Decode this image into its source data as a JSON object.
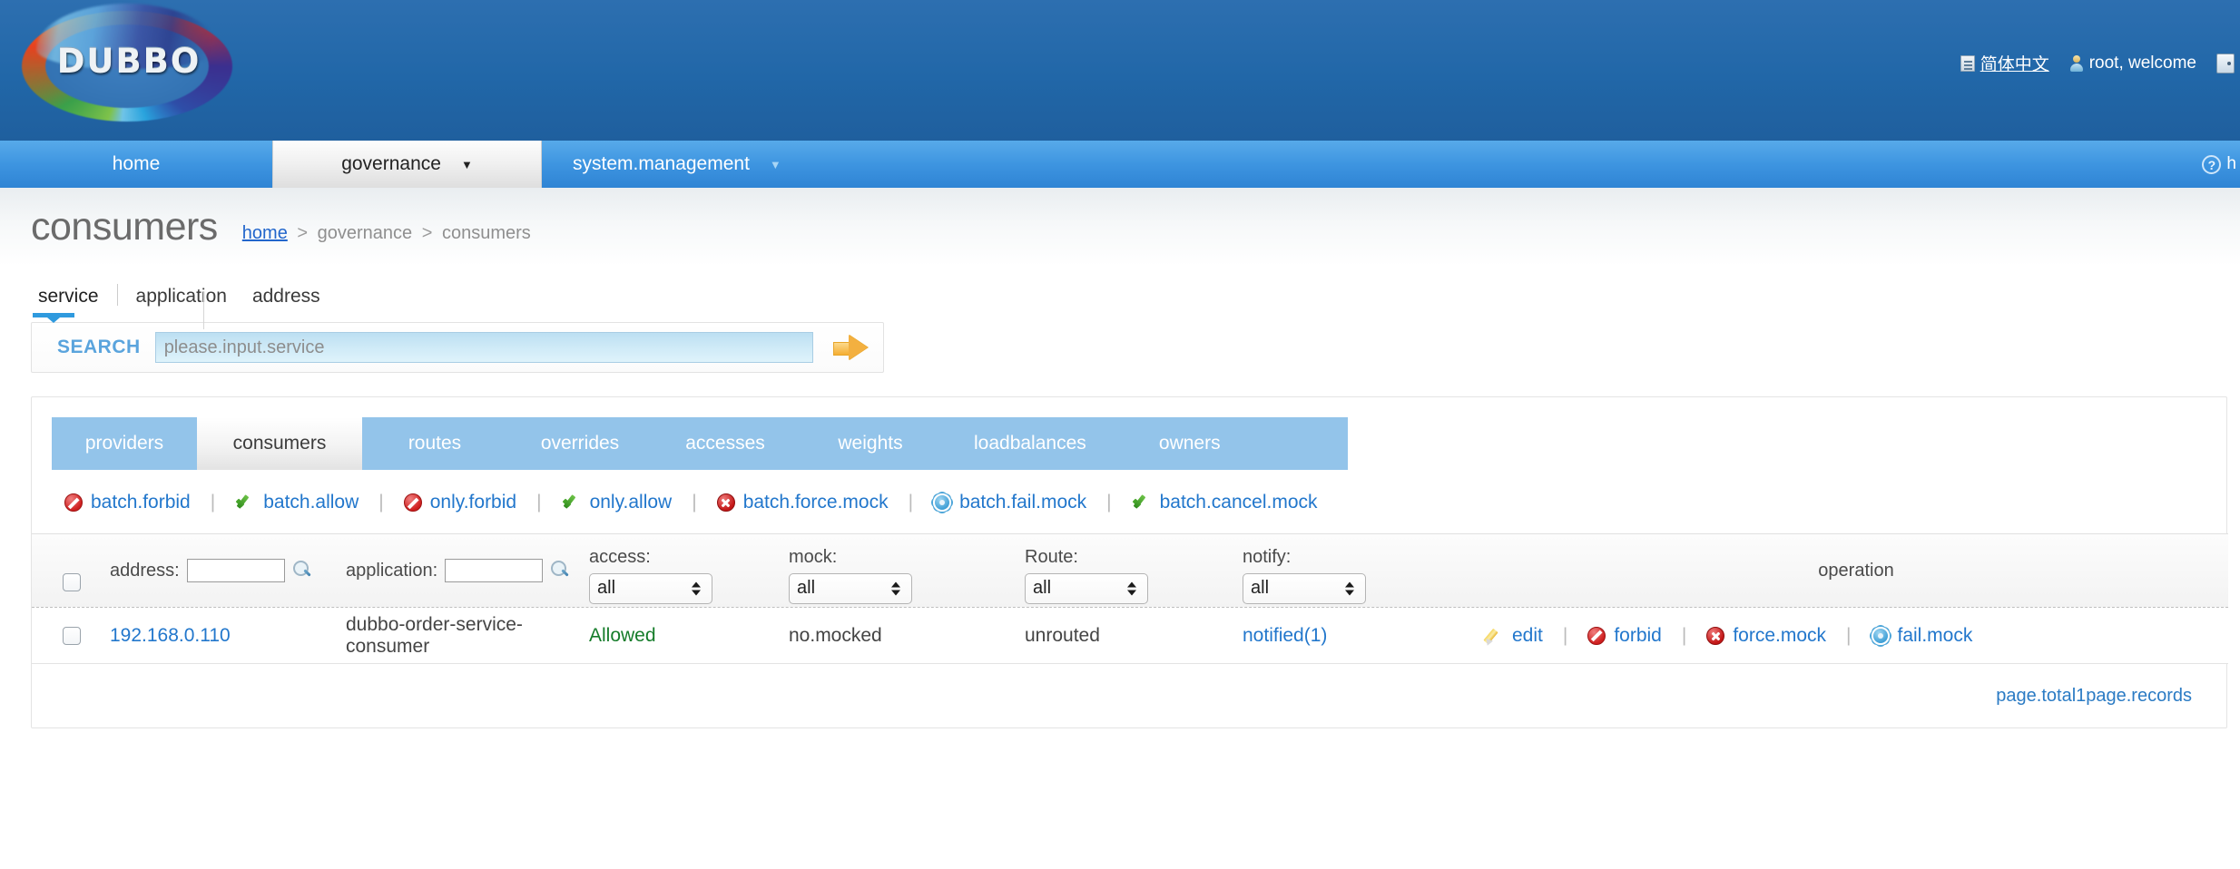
{
  "header": {
    "logo_text": "DUBBO",
    "language_link": "简体中文",
    "language_icon": "document-icon",
    "user_greeting": "root, welcome",
    "user_icon": "user-icon",
    "logout_icon": "door-exit-icon"
  },
  "nav": {
    "items": [
      {
        "label": "home",
        "active": false,
        "caret": false
      },
      {
        "label": "governance",
        "active": true,
        "caret": true
      },
      {
        "label": "system.management",
        "active": false,
        "caret": true
      }
    ],
    "help_icon": "question-circle-icon",
    "help_label": "h"
  },
  "page": {
    "title": "consumers",
    "breadcrumb": {
      "home": "home",
      "sep1": ">",
      "governance": "governance",
      "sep2": ">",
      "current": "consumers"
    }
  },
  "subtabs": {
    "items": [
      {
        "label": "service",
        "selected": true
      },
      {
        "label": "application",
        "selected": false
      },
      {
        "label": "address",
        "selected": false
      }
    ]
  },
  "search": {
    "label": "SEARCH",
    "placeholder": "please.input.service",
    "value": "",
    "submit_icon": "arrow-right-icon"
  },
  "tabs": {
    "items": [
      {
        "label": "providers",
        "active": false
      },
      {
        "label": "consumers",
        "active": true
      },
      {
        "label": "routes",
        "active": false
      },
      {
        "label": "overrides",
        "active": false
      },
      {
        "label": "accesses",
        "active": false
      },
      {
        "label": "weights",
        "active": false
      },
      {
        "label": "loadbalances",
        "active": false
      },
      {
        "label": "owners",
        "active": false
      }
    ]
  },
  "batch_actions": [
    {
      "label": "batch.forbid",
      "icon": "forbid-icon"
    },
    {
      "label": "batch.allow",
      "icon": "check-icon"
    },
    {
      "label": "only.forbid",
      "icon": "forbid-icon"
    },
    {
      "label": "only.allow",
      "icon": "check-icon"
    },
    {
      "label": "batch.force.mock",
      "icon": "error-circle-icon"
    },
    {
      "label": "batch.fail.mock",
      "icon": "gear-icon"
    },
    {
      "label": "batch.cancel.mock",
      "icon": "check-icon"
    }
  ],
  "separator": "|",
  "filters": {
    "address_label": "address:",
    "address_value": "",
    "address_search_icon": "magnifier-icon",
    "application_label": "application:",
    "application_value": "",
    "application_search_icon": "magnifier-icon",
    "access_label": "access:",
    "access_value": "all",
    "mock_label": "mock:",
    "mock_value": "all",
    "route_label": "Route:",
    "route_value": "all",
    "notify_label": "notify:",
    "notify_value": "all",
    "operation_label": "operation"
  },
  "rows": [
    {
      "address": "192.168.0.110",
      "application": "dubbo-order-service-consumer",
      "access": "Allowed",
      "mock": "no.mocked",
      "route": "unrouted",
      "notify": "notified(1)",
      "operations": [
        {
          "label": "edit",
          "icon": "pencil-icon"
        },
        {
          "label": "forbid",
          "icon": "forbid-icon"
        },
        {
          "label": "force.mock",
          "icon": "error-circle-icon"
        },
        {
          "label": "fail.mock",
          "icon": "gear-icon"
        }
      ]
    }
  ],
  "pager": {
    "text": "page.total1page.records"
  },
  "colors": {
    "header_blue": "#2167ab",
    "nav_blue": "#3d94e0",
    "tabstrip_blue": "#93c4ea",
    "link_blue": "#2277cc",
    "allowed_green": "#157c2a",
    "search_label_blue": "#5aa4dd"
  }
}
